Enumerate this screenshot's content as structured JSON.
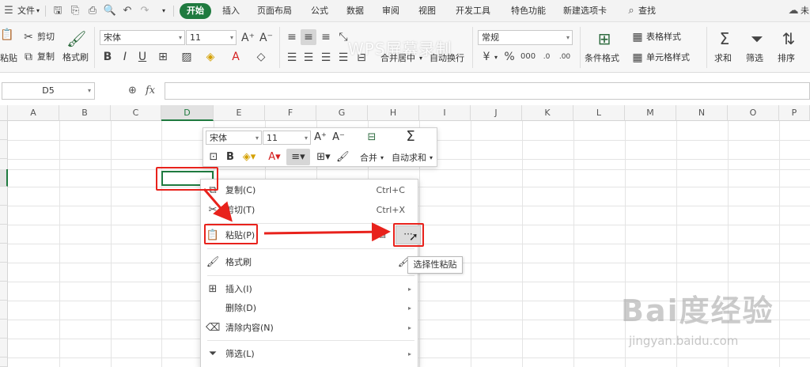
{
  "menu": {
    "file": "文件",
    "tabs": [
      "插入",
      "页面布局",
      "公式",
      "数据",
      "审阅",
      "视图",
      "开发工具",
      "特色功能",
      "新建选项卡"
    ],
    "active_tab": "开始",
    "search": "查找",
    "user_partial": "未"
  },
  "ribbon": {
    "cut": "剪切",
    "paste_partial": "粘贴",
    "copy": "复制",
    "format_painter": "格式刷",
    "font_name": "宋体",
    "font_size": "11",
    "watermark": "WPS屏幕录制",
    "number_format": "常规",
    "merge_center": "合并居中",
    "wrap_text": "自动换行",
    "percent_sym": "%",
    "conditional_format": "条件格式",
    "table_style": "表格样式",
    "cell_style": "单元格样式",
    "sum": "求和",
    "filter": "筛选",
    "sort": "排序"
  },
  "formula_bar": {
    "name_box": "D5",
    "fx": "fx"
  },
  "columns": [
    "A",
    "B",
    "C",
    "D",
    "E",
    "F",
    "G",
    "H",
    "I",
    "J",
    "K",
    "L",
    "M",
    "N",
    "O",
    "P"
  ],
  "active_column": "D",
  "mini_toolbar": {
    "font_name": "宋体",
    "font_size": "11",
    "bold": "B",
    "merge": "合并",
    "autosum": "自动求和"
  },
  "context_menu": {
    "items": [
      {
        "label": "复制(C)",
        "shortcut": "Ctrl+C"
      },
      {
        "label": "剪切(T)",
        "shortcut": "Ctrl+X"
      },
      {
        "label": "粘贴(P)",
        "shortcut": ""
      },
      {
        "label": "格式刷",
        "shortcut": ""
      },
      {
        "label": "插入(I)",
        "shortcut": ""
      },
      {
        "label": "删除(D)",
        "shortcut": ""
      },
      {
        "label": "清除内容(N)",
        "shortcut": ""
      },
      {
        "label": "筛选(L)",
        "shortcut": ""
      }
    ],
    "more_button": "···",
    "tooltip": "选择性粘贴"
  },
  "watermark_baidu": {
    "brand": "Bai度经验",
    "url": "jingyan.baidu.com"
  },
  "colors": {
    "accent": "#1f7a3f",
    "annotation": "#e8221c"
  }
}
